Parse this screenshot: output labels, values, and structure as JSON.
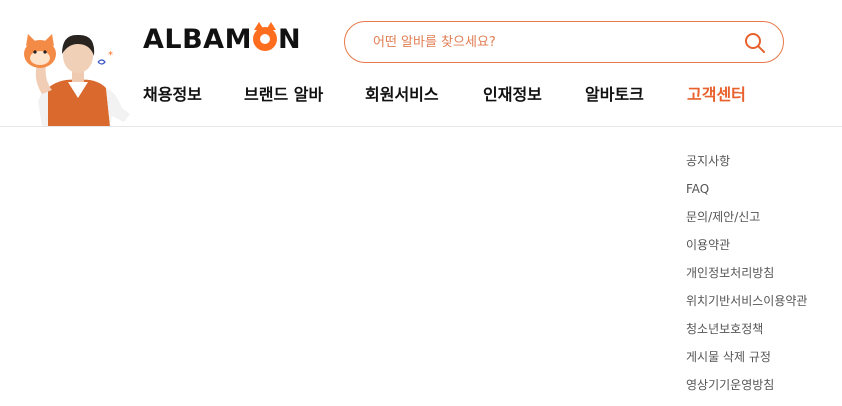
{
  "logo": {
    "before": "ALBAM",
    "after": "N"
  },
  "search": {
    "placeholder": "어떤 알바를 찾으세요?"
  },
  "nav": {
    "items": [
      {
        "label": "채용정보"
      },
      {
        "label": "브랜드 알바"
      },
      {
        "label": "회원서비스"
      },
      {
        "label": "인재정보"
      },
      {
        "label": "알바토크"
      },
      {
        "label": "고객센터",
        "active": true
      }
    ]
  },
  "support_menu": {
    "items": [
      {
        "label": "공지사항"
      },
      {
        "label": "FAQ"
      },
      {
        "label": "문의/제안/신고"
      },
      {
        "label": "이용약관"
      },
      {
        "label": "개인정보처리방침"
      },
      {
        "label": "위치기반서비스이용약관"
      },
      {
        "label": "청소년보호정책"
      },
      {
        "label": "게시물 삭제 규정"
      },
      {
        "label": "영상기기운영방침"
      }
    ]
  },
  "colors": {
    "accent": "#e8612d",
    "brand_orange": "#ff6e1f",
    "search_border": "#e8794a"
  }
}
